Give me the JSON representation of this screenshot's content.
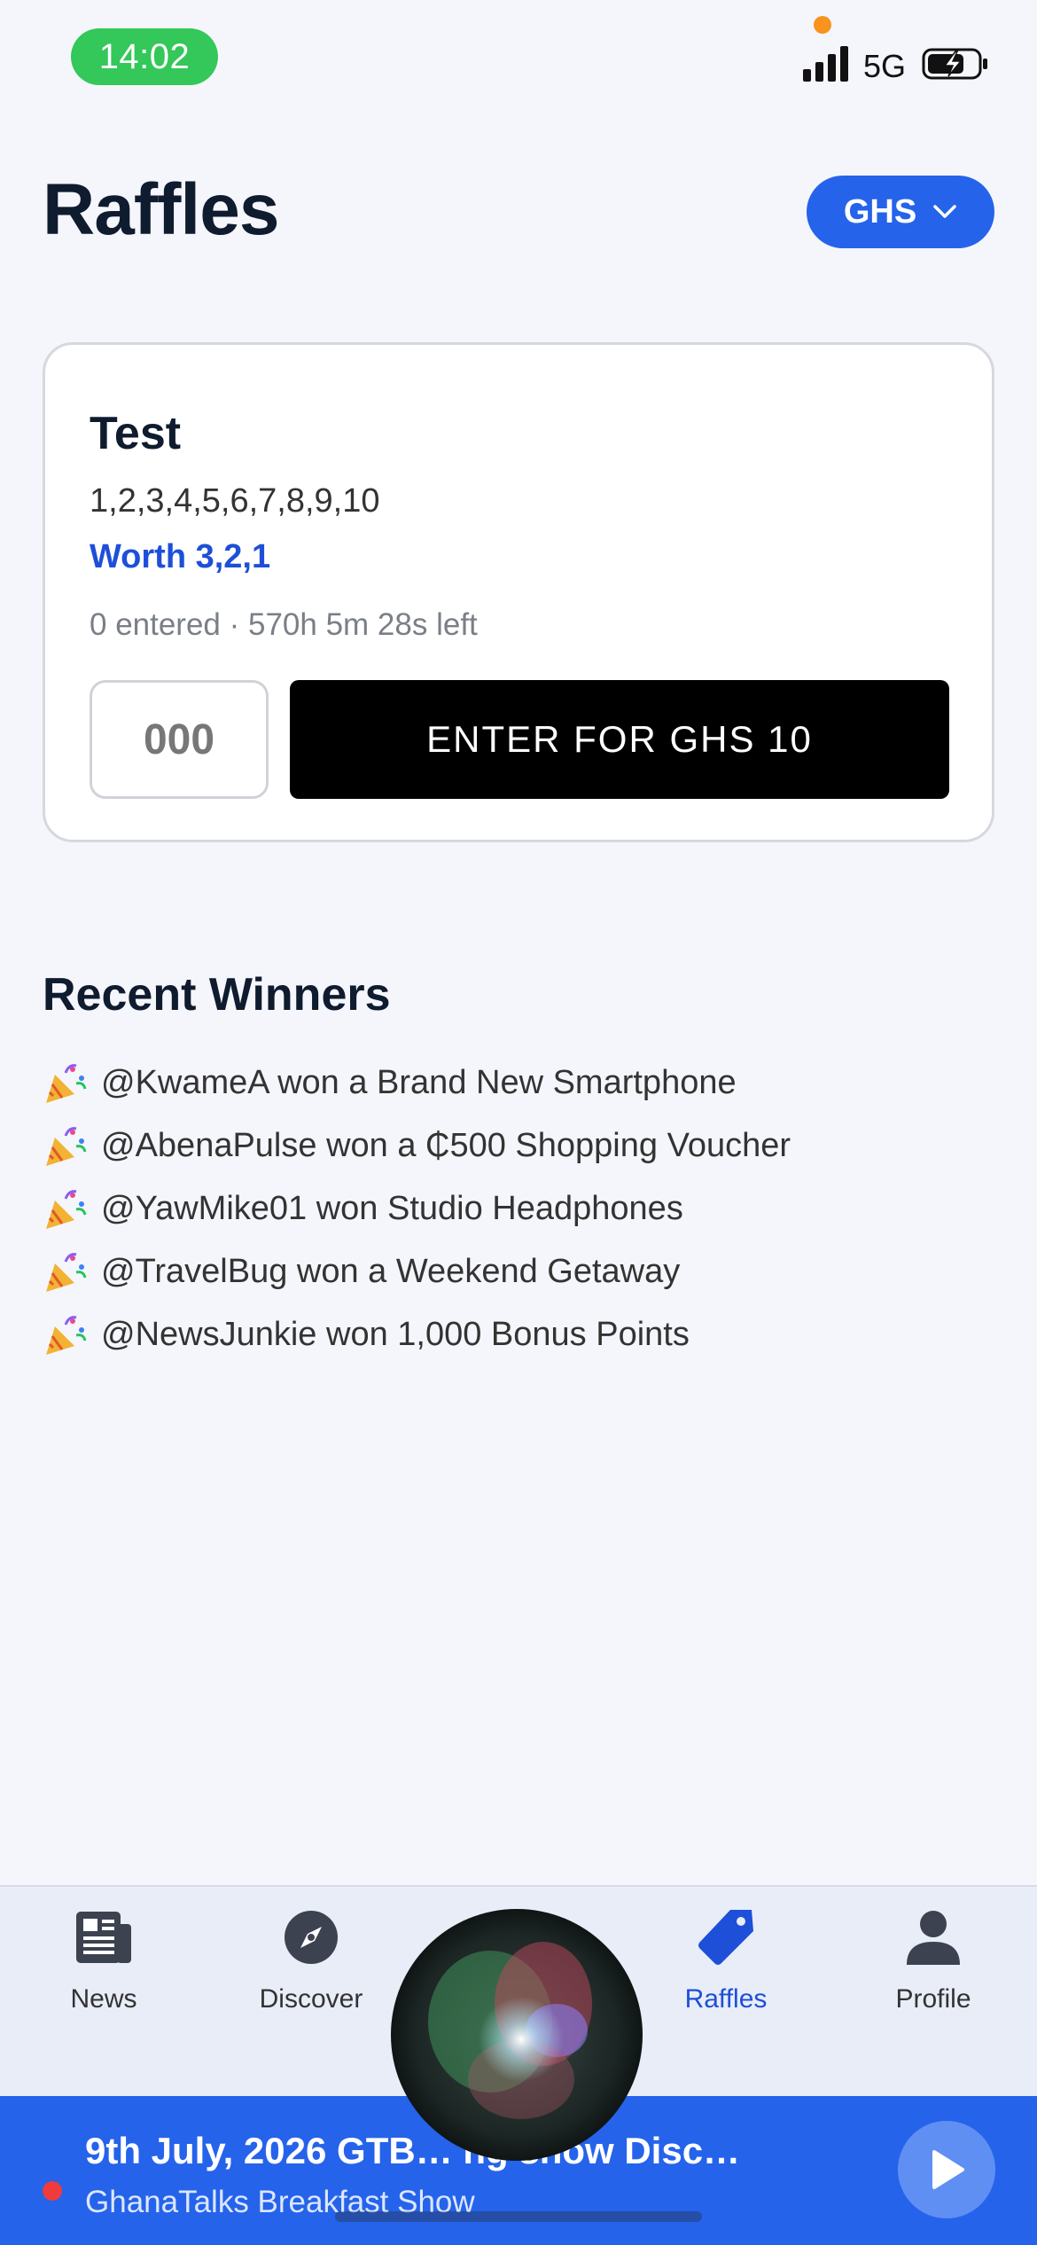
{
  "status_bar": {
    "time": "14:02",
    "network": "5G",
    "icons": [
      "signal-icon",
      "battery-charging-icon"
    ],
    "time_pill_color": "#34c759"
  },
  "header": {
    "title": "Raffles",
    "currency": "GHS"
  },
  "raffle": {
    "title": "Test",
    "numbers": "1,2,3,4,5,6,7,8,9,10",
    "worth": "Worth 3,2,1",
    "meta": "0 entered · 570h 5m 28s left",
    "ticket_placeholder": "000",
    "enter_label": "ENTER FOR GHS 10"
  },
  "winners": {
    "title": "Recent Winners",
    "items": [
      {
        "text": "@KwameA won a Brand New Smartphone",
        "icon": "party-popper-icon"
      },
      {
        "text": "@AbenaPulse won a ₵500 Shopping Voucher",
        "icon": "party-popper-icon"
      },
      {
        "text": "@YawMike01 won Studio Headphones",
        "icon": "party-popper-icon"
      },
      {
        "text": "@TravelBug won a Weekend Getaway",
        "icon": "party-popper-icon"
      },
      {
        "text": "@NewsJunkie won 1,000 Bonus Points",
        "icon": "party-popper-icon"
      }
    ]
  },
  "nav": {
    "items": [
      {
        "label": "News",
        "icon": "newspaper-icon",
        "active": false
      },
      {
        "label": "Discover",
        "icon": "compass-icon",
        "active": false
      },
      {
        "label": "",
        "icon": "",
        "active": false
      },
      {
        "label": "Raffles",
        "icon": "tag-icon",
        "active": true
      },
      {
        "label": "Profile",
        "icon": "user-icon",
        "active": false
      }
    ]
  },
  "player": {
    "title": "9th July, 2026  GTB… ng show Disc…",
    "subtitle": "GhanaTalks Breakfast Show"
  },
  "colors": {
    "primary": "#2563eb",
    "accent_text": "#1d4fd8",
    "live": "#ef3b3b"
  }
}
